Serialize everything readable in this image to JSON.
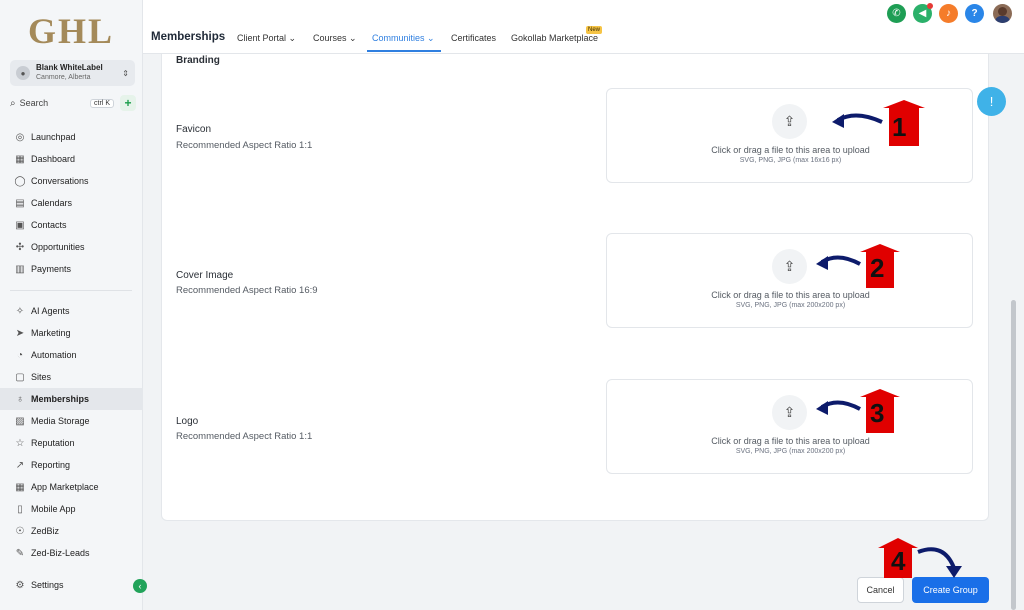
{
  "sidebar": {
    "logo": "GHL",
    "account": {
      "name": "Blank WhiteLabel",
      "location": "Canmore, Alberta"
    },
    "search": {
      "label": "Search",
      "shortcut": "ctrl K"
    },
    "items": [
      {
        "label": "Launchpad",
        "icon": "rocket-icon"
      },
      {
        "label": "Dashboard",
        "icon": "grid-icon"
      },
      {
        "label": "Conversations",
        "icon": "chat-icon"
      },
      {
        "label": "Calendars",
        "icon": "calendar-icon"
      },
      {
        "label": "Contacts",
        "icon": "contacts-icon"
      },
      {
        "label": "Opportunities",
        "icon": "opportunities-icon"
      },
      {
        "label": "Payments",
        "icon": "payments-icon"
      },
      {
        "label": "AI Agents",
        "icon": "sparkle-icon"
      },
      {
        "label": "Marketing",
        "icon": "send-icon"
      },
      {
        "label": "Automation",
        "icon": "automation-icon"
      },
      {
        "label": "Sites",
        "icon": "sites-icon"
      },
      {
        "label": "Memberships",
        "icon": "badge-icon"
      },
      {
        "label": "Media Storage",
        "icon": "image-icon"
      },
      {
        "label": "Reputation",
        "icon": "star-icon"
      },
      {
        "label": "Reporting",
        "icon": "chart-icon"
      },
      {
        "label": "App Marketplace",
        "icon": "apps-icon"
      },
      {
        "label": "Mobile App",
        "icon": "phone-icon"
      },
      {
        "label": "ZedBiz",
        "icon": "zedbiz-icon"
      },
      {
        "label": "Zed-Biz-Leads",
        "icon": "wrench-icon"
      },
      {
        "label": "Settings",
        "icon": "gear-icon"
      }
    ],
    "active": "Memberships"
  },
  "header": {
    "title": "Memberships",
    "tabs": [
      {
        "label": "Client Portal",
        "has_dropdown": true
      },
      {
        "label": "Courses",
        "has_dropdown": true
      },
      {
        "label": "Communities",
        "has_dropdown": true
      },
      {
        "label": "Certificates",
        "has_dropdown": false
      },
      {
        "label": "Gokollab Marketplace",
        "has_dropdown": false
      }
    ],
    "active_tab": "Communities",
    "new_badge": "New",
    "icons": [
      {
        "name": "phone-icon",
        "color": "#1e9e54",
        "glyph": "✆"
      },
      {
        "name": "megaphone-icon",
        "color": "#2bb06a",
        "glyph": "📢"
      },
      {
        "name": "bell-icon",
        "color": "#f57c2a",
        "glyph": "🔔"
      },
      {
        "name": "help-icon",
        "color": "#2a86e8",
        "glyph": "?"
      }
    ]
  },
  "main": {
    "section_title": "Branding",
    "uploads": [
      {
        "label": "Favicon",
        "ratio": "Recommended Aspect Ratio 1:1",
        "text": "Click or drag a file to this area to upload",
        "hint": "SVG, PNG, JPG (max 16x16 px)"
      },
      {
        "label": "Cover Image",
        "ratio": "Recommended Aspect Ratio 16:9",
        "text": "Click or drag a file to this area to upload",
        "hint": "SVG, PNG, JPG (max 200x200 px)"
      },
      {
        "label": "Logo",
        "ratio": "Recommended Aspect Ratio 1:1",
        "text": "Click or drag a file to this area to upload",
        "hint": "SVG, PNG, JPG (max 200x200 px)"
      }
    ]
  },
  "footer": {
    "cancel_label": "Cancel",
    "create_label": "Create Group"
  },
  "annotations": [
    "1",
    "2",
    "3",
    "4"
  ],
  "colors": {
    "accent": "#1a6fe8",
    "active_tab": "#2f7fe0",
    "marker": "#e00000",
    "arrow": "#0d1b6b"
  }
}
